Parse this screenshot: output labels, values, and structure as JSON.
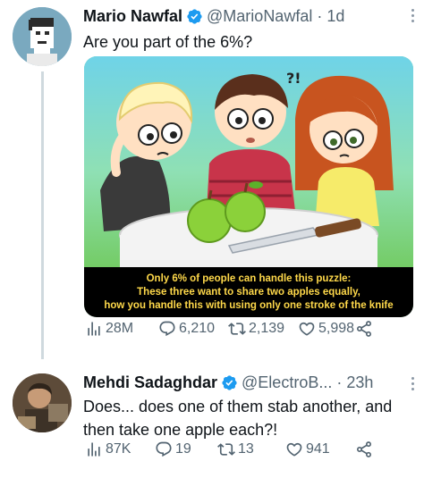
{
  "tweets": [
    {
      "author_name": "Mario Nawfal",
      "handle": "@MarioNawfal",
      "separator": "·",
      "time": "1d",
      "text": "Are you part of the 6%?",
      "media": {
        "caption_lines": [
          "Only 6% of people can handle this puzzle:",
          "These three want to share two apples equally,",
          "how you handle this with using only one stroke of the knife"
        ],
        "thought_marks": "?!"
      },
      "stats": {
        "views": "28M",
        "replies": "6,210",
        "retweets": "2,139",
        "likes": "5,998"
      }
    },
    {
      "author_name": "Mehdi Sadaghdar",
      "handle": "@ElectroB...",
      "separator": "·",
      "time": "23h",
      "text": "Does... does one of them stab another, and then take one apple each?!",
      "stats": {
        "views": "87K",
        "replies": "19",
        "retweets": "13",
        "likes": "941"
      }
    }
  ],
  "colors": {
    "verified": "#1d9bf0",
    "muted": "#536471",
    "caption": "#ffd94a"
  },
  "icons": [
    "verified-badge-icon",
    "more-icon",
    "views-icon",
    "reply-icon",
    "retweet-icon",
    "like-icon",
    "share-icon"
  ]
}
